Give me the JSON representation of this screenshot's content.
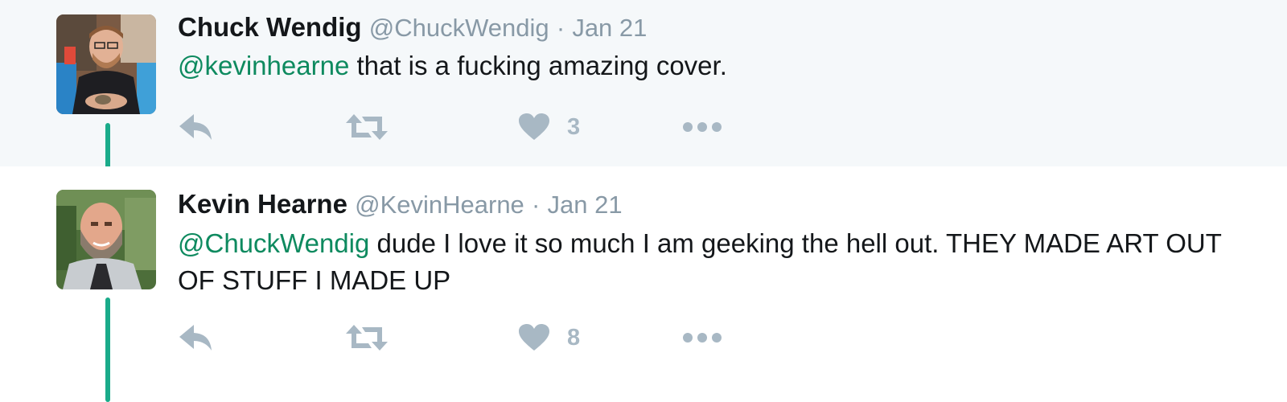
{
  "tweets": [
    {
      "name": "Chuck Wendig",
      "handle": "@ChuckWendig",
      "separator": "·",
      "date": "Jan 21",
      "mention": "@kevinhearne",
      "text": " that is a fucking amazing cover.",
      "like_count": "3"
    },
    {
      "name": "Kevin Hearne",
      "handle": "@KevinHearne",
      "separator": "·",
      "date": "Jan 21",
      "mention": "@ChuckWendig",
      "text": " dude I love it so much I am geeking the hell out. THEY MADE ART OUT OF STUFF I MADE UP",
      "like_count": "8"
    }
  ],
  "colors": {
    "mention": "#0e8a5f",
    "thread_line": "#1aab8a",
    "muted": "#8899a6",
    "action_icon": "#a8b8c4",
    "highlight_background": "#f5f8fa"
  },
  "icons": [
    "reply-icon",
    "retweet-icon",
    "like-icon",
    "more-icon"
  ]
}
